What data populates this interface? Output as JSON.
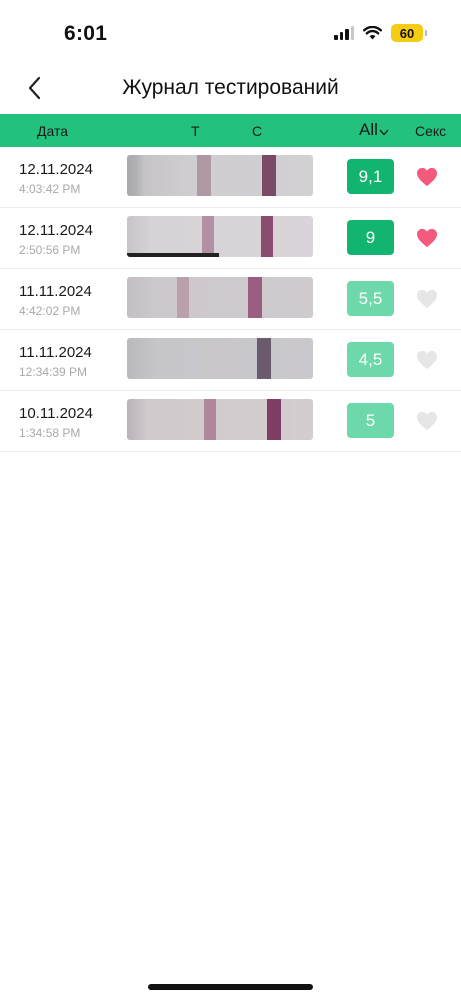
{
  "status_bar": {
    "time": "6:01",
    "battery": "60"
  },
  "header": {
    "title": "Журнал тестирований",
    "back_icon": "chevron-left-icon"
  },
  "columns": {
    "date": "Дата",
    "t": "T",
    "c": "C",
    "filter": "All",
    "sex": "Секс"
  },
  "colors": {
    "accent": "#22c17d",
    "score_dark": "#12b46f",
    "score_light": "#6dd8a9",
    "heart_on": "#f45a7e",
    "heart_off": "#e6e6e6"
  },
  "entries": [
    {
      "date": "12.11.2024",
      "time": "4:03:42 PM",
      "score": "9,1",
      "score_level": "high",
      "sex": true
    },
    {
      "date": "12.11.2024",
      "time": "2:50:56 PM",
      "score": "9",
      "score_level": "high",
      "sex": true
    },
    {
      "date": "11.11.2024",
      "time": "4:42:02 PM",
      "score": "5,5",
      "score_level": "low",
      "sex": false
    },
    {
      "date": "11.11.2024",
      "time": "12:34:39 PM",
      "score": "4,5",
      "score_level": "low",
      "sex": false
    },
    {
      "date": "10.11.2024",
      "time": "1:34:58 PM",
      "score": "5",
      "score_level": "low",
      "sex": false
    }
  ]
}
